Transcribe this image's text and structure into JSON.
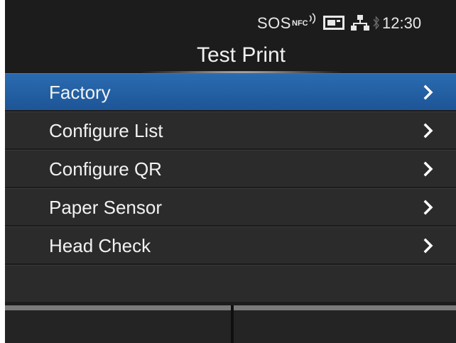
{
  "status_bar": {
    "sos": "SOS",
    "nfc": "NFC",
    "time": "12:30",
    "icons": [
      "nfc-icon",
      "sd-card-icon",
      "network-icon",
      "bluetooth-icon"
    ]
  },
  "title": "Test Print",
  "menu": {
    "items": [
      {
        "label": "Factory",
        "selected": true
      },
      {
        "label": "Configure List",
        "selected": false
      },
      {
        "label": "Configure QR",
        "selected": false
      },
      {
        "label": "Paper Sensor",
        "selected": false
      },
      {
        "label": "Head Check",
        "selected": false
      }
    ]
  },
  "function_keys": {
    "left_label": "",
    "right_label": ""
  },
  "colors": {
    "background": "#1c1c1c",
    "selected_row": "#2a6bb0",
    "row": "#2b2b2b",
    "text": "#f2f2f2",
    "fkey_bar": "#7a7a7a"
  }
}
